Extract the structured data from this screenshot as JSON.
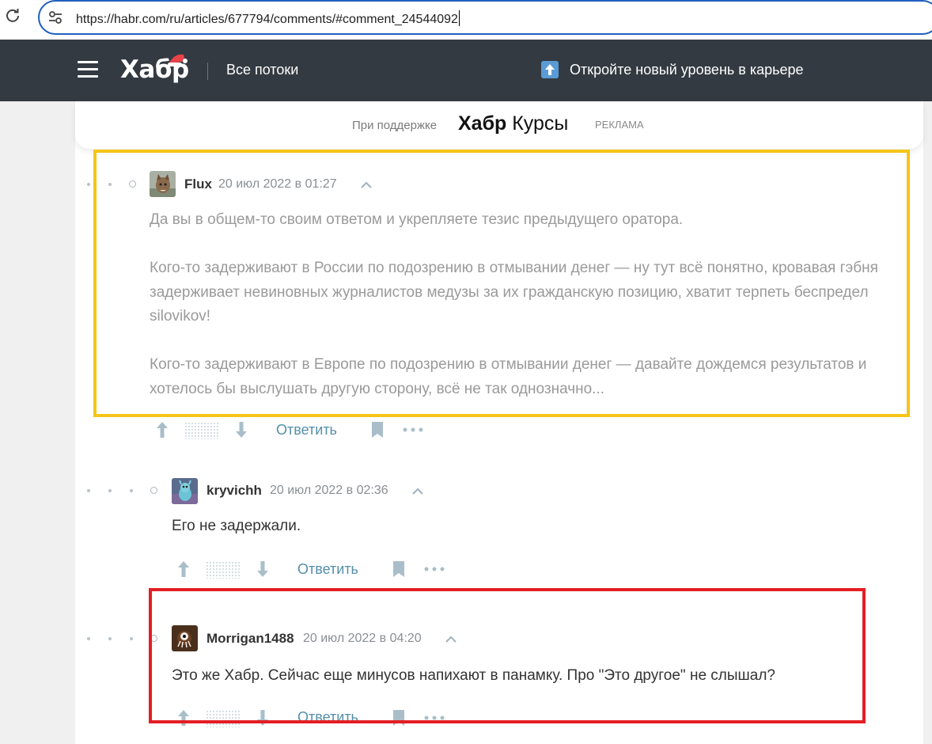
{
  "browser": {
    "url": "https://habr.com/ru/articles/677794/comments/#comment_24544092",
    "reload_icon": "reload-icon",
    "site_settings_icon": "site-settings-icon"
  },
  "header": {
    "logo": "Хабр",
    "all_streams": "Все потоки",
    "career_promo": "Откройте новый уровень в карьере",
    "background": "#333a41"
  },
  "sponsor": {
    "label": "При поддержке",
    "brand_bold": "Хабр",
    "brand_rest": " Курсы",
    "ad_label": "РЕКЛАМА"
  },
  "comments": [
    {
      "username": "Flux",
      "date": "20 июл 2022 в 01:27",
      "paragraphs": [
        "Да вы в общем-то своим ответом и укрепляете тезис предыдущего оратора.",
        "Кого-то задерживают в России по подозрению в отмывании денег — ну тут всё понятно, кровавая гэбня задерживает невиновных журналистов медузы за их гражданскую позицию, хватит терпеть беспредел silovikov!",
        "Кого-то задерживают в Европе по подозрению в отмывании денег — давайте дождемся результатов и хотелось бы выслушать другую сторону, всё не так однозначно..."
      ],
      "reply_label": "Ответить"
    },
    {
      "username": "kryvichh",
      "date": "20 июл 2022 в 02:36",
      "paragraphs": [
        "Его не задержали."
      ],
      "reply_label": "Ответить"
    },
    {
      "username": "Morrigan1488",
      "date": "20 июл 2022 в 04:20",
      "paragraphs": [
        "Это же Хабр. Сейчас еще минусов напихают в панамку. Про \"Это другое\" не слышал?"
      ],
      "reply_label": "Ответить"
    }
  ],
  "colors": {
    "accent_link": "#548eaa",
    "highlight_yellow": "#f5c518",
    "highlight_red": "#e31e24"
  }
}
